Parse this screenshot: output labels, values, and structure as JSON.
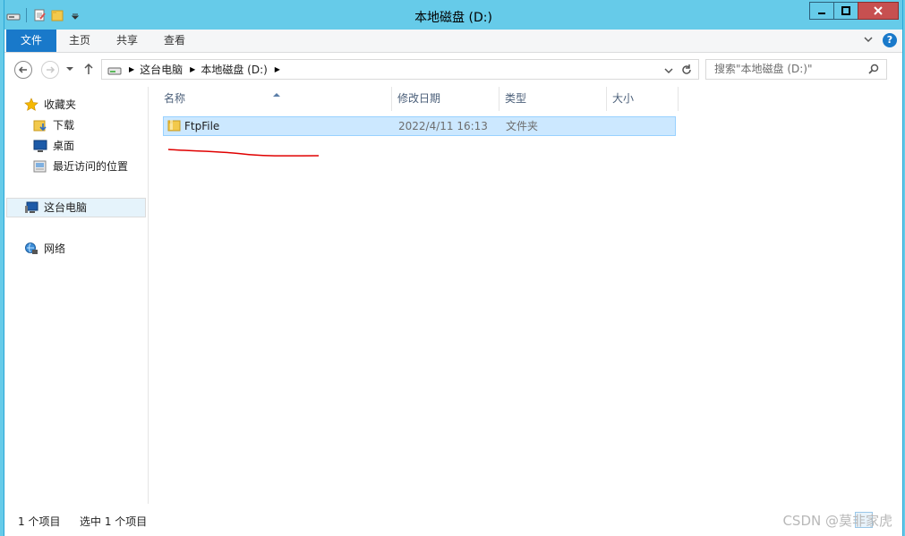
{
  "window": {
    "title": "本地磁盘 (D:)"
  },
  "ribbon": {
    "tabs": [
      "文件",
      "主页",
      "共享",
      "查看"
    ]
  },
  "address": {
    "crumbs": [
      "这台电脑",
      "本地磁盘 (D:)"
    ],
    "search_placeholder": "搜索\"本地磁盘 (D:)\""
  },
  "nav": {
    "favorites_label": "收藏夹",
    "favorites": [
      "下载",
      "桌面",
      "最近访问的位置"
    ],
    "this_pc_label": "这台电脑",
    "network_label": "网络"
  },
  "columns": [
    "名称",
    "修改日期",
    "类型",
    "大小"
  ],
  "files": [
    {
      "name": "FtpFile",
      "modified": "2022/4/11 16:13",
      "type": "文件夹",
      "size": ""
    }
  ],
  "status": {
    "count": "1 个项目",
    "selected": "选中 1 个项目"
  },
  "watermark": "CSDN @莫非家虎",
  "colors": {
    "accent": "#1979ca",
    "titlebar": "#66cbe9",
    "selection": "#cce8ff",
    "annotation": "#e00000"
  }
}
